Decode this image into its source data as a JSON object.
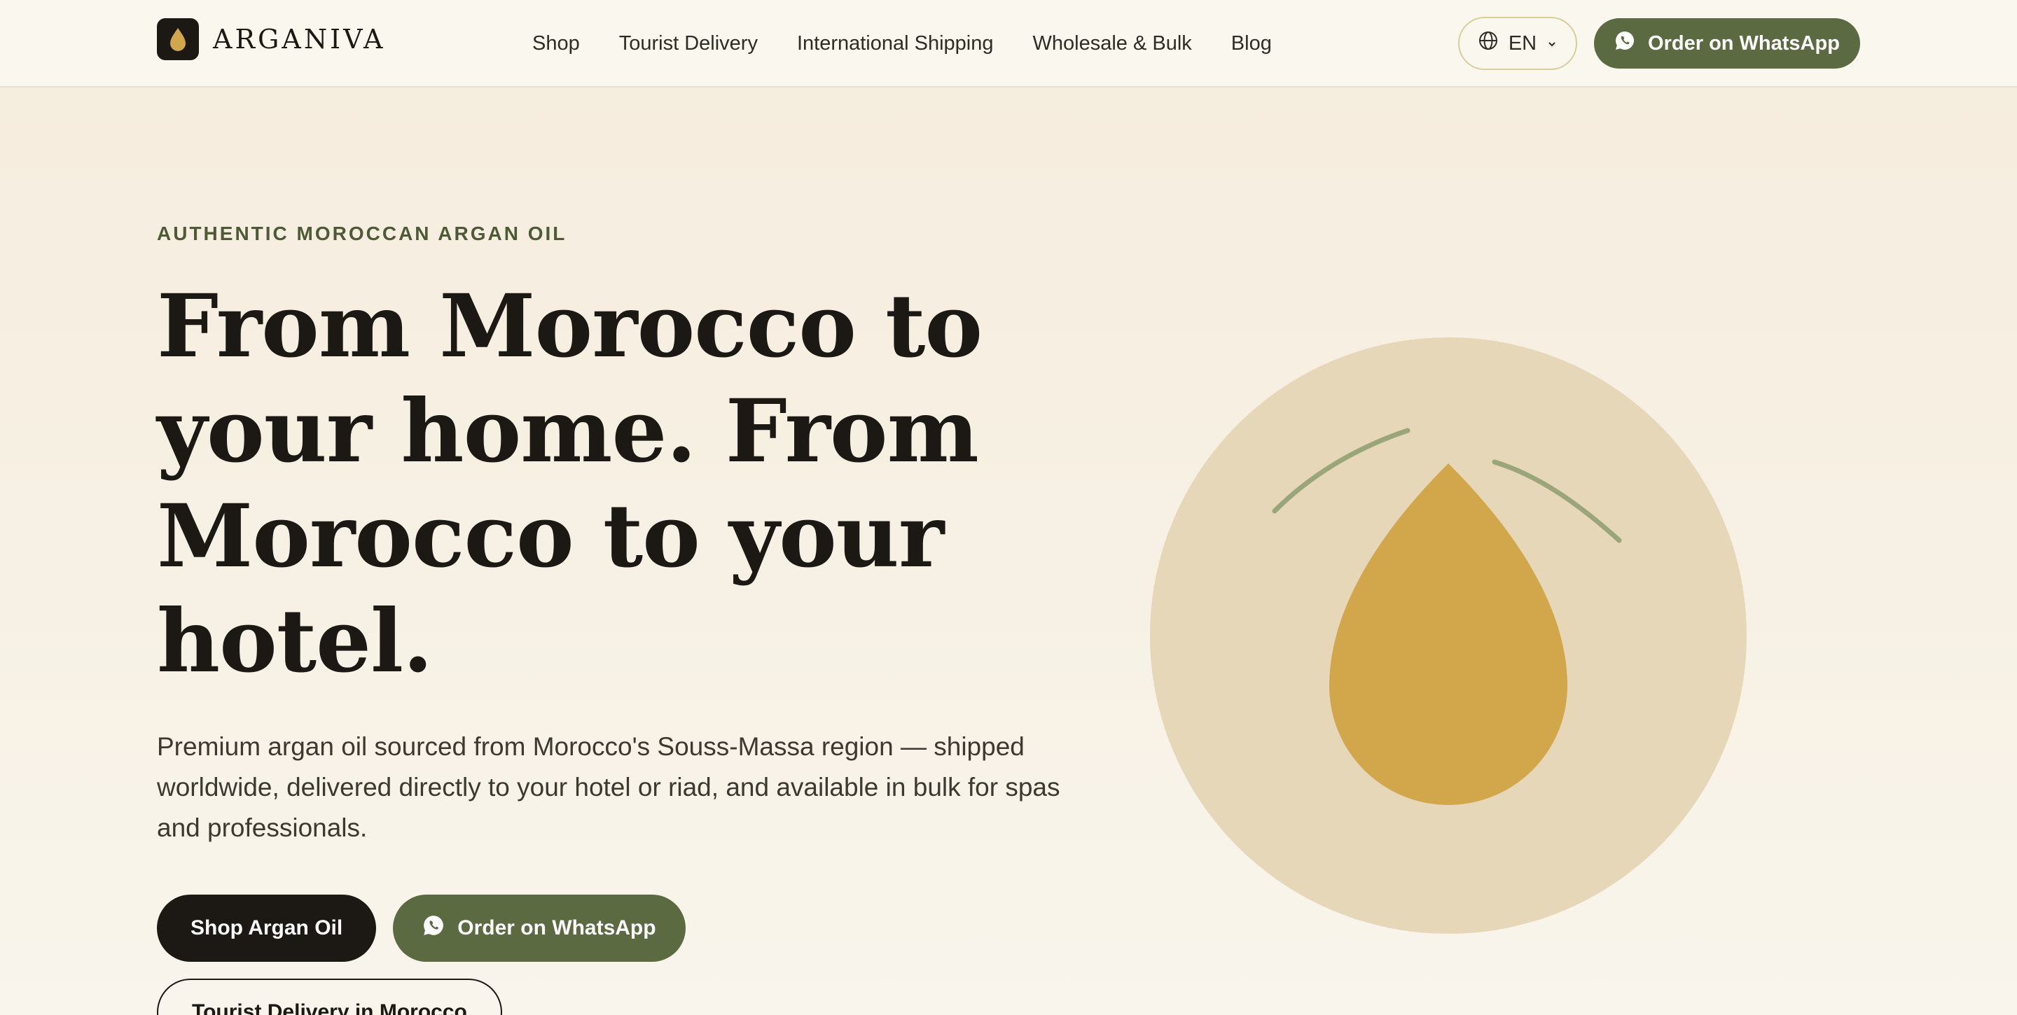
{
  "header": {
    "brand": "ARGANIVA",
    "nav": [
      {
        "label": "Shop"
      },
      {
        "label": "Tourist Delivery"
      },
      {
        "label": "International Shipping"
      },
      {
        "label": "Wholesale & Bulk"
      },
      {
        "label": "Blog"
      }
    ],
    "language": "EN",
    "whatsapp_label": "Order on WhatsApp"
  },
  "hero": {
    "eyebrow": "AUTHENTIC MOROCCAN ARGAN OIL",
    "title": "From Morocco to your home. From Morocco to your hotel.",
    "description": "Premium argan oil sourced from Morocco's Souss-Massa region — shipped worldwide, delivered directly to your hotel or riad, and available in bulk for spas and professionals.",
    "cta_primary": "Shop Argan Oil",
    "cta_whatsapp": "Order on WhatsApp",
    "cta_tourist": "Tourist Delivery in Morocco"
  },
  "icons": {
    "logo": "argan-drop-icon",
    "language": "globe-icon",
    "dropdown": "chevron-down-icon",
    "whatsapp": "whatsapp-icon",
    "illustration": "oil-drop-illustration"
  },
  "colors": {
    "brand_dark": "#1c1915",
    "accent_green": "#5b6a40",
    "gold": "#d2a64a",
    "circle": "#e6d7b9",
    "leaf": "#9aa57a",
    "background": "#f6efe2"
  }
}
